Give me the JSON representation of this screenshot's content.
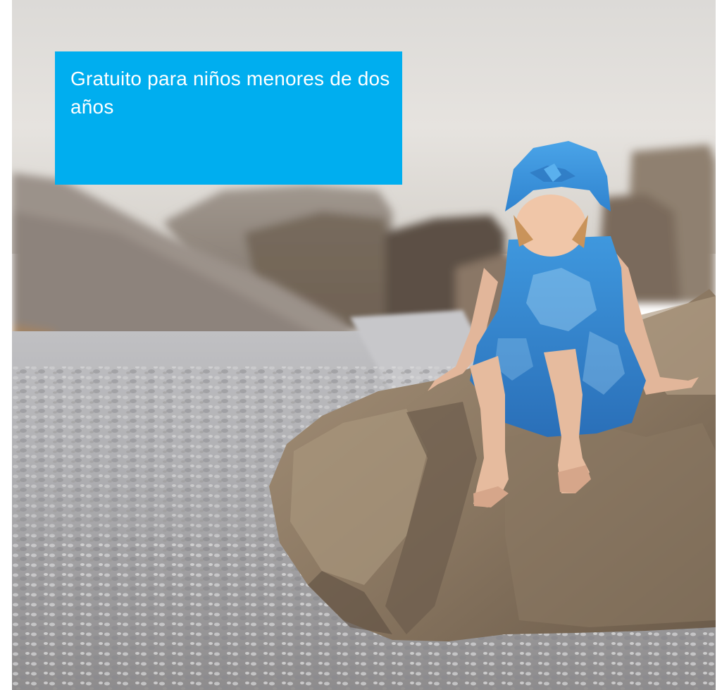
{
  "caption": {
    "text": "Gratuito para niños menores de dos años"
  },
  "colors": {
    "caption_background": "#00AEEF",
    "sky": "#E3E1DE",
    "pebbles": "#A9A9AB",
    "rock": "#8C7A64",
    "dress": "#3A90D8"
  },
  "image": {
    "subject": "child in blue hat and blue dress sitting on a large rock on a pebble beach"
  }
}
